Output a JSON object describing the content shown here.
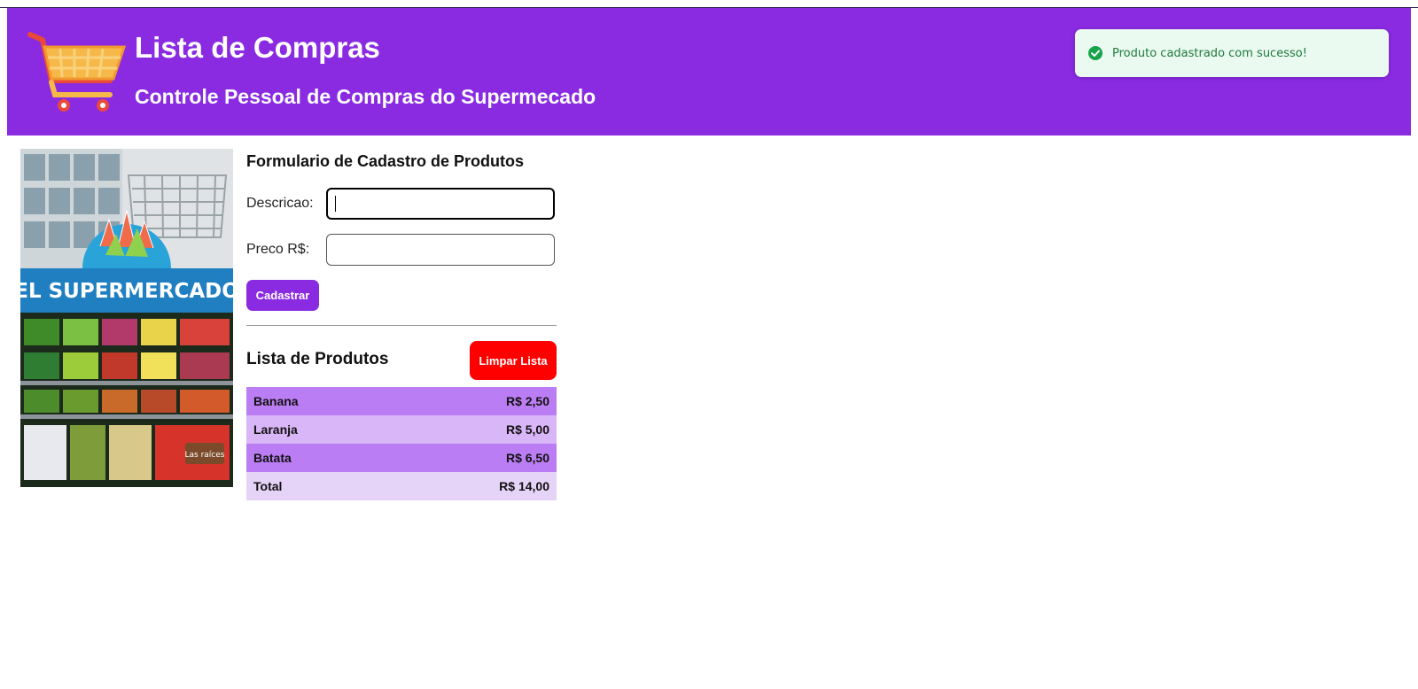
{
  "header": {
    "title": "Lista de Compras",
    "subtitle": "Controle Pessoal de Compras do Supermecado",
    "logo_icon": "shopping-cart-icon",
    "bg_color": "#8a2be2"
  },
  "toast": {
    "message": "Produto cadastrado com sucesso!",
    "icon": "check-circle-icon",
    "color": "#1f7a3a"
  },
  "photo": {
    "sign_text": "EL SUPERMERCADO",
    "badge_text": "Las raíces"
  },
  "form": {
    "title": "Formulario de Cadastro de Produtos",
    "descricao_label": "Descricao:",
    "descricao_value": "",
    "preco_label": "Preco R$:",
    "preco_value": "",
    "submit_label": "Cadastrar"
  },
  "list": {
    "title": "Lista de Produtos",
    "clear_label": "Limpar Lista",
    "items": [
      {
        "name": "Banana",
        "price": "R$ 2,50"
      },
      {
        "name": "Laranja",
        "price": "R$ 5,00"
      },
      {
        "name": "Batata",
        "price": "R$ 6,50"
      }
    ],
    "total_label": "Total",
    "total_value": "R$ 14,00"
  }
}
